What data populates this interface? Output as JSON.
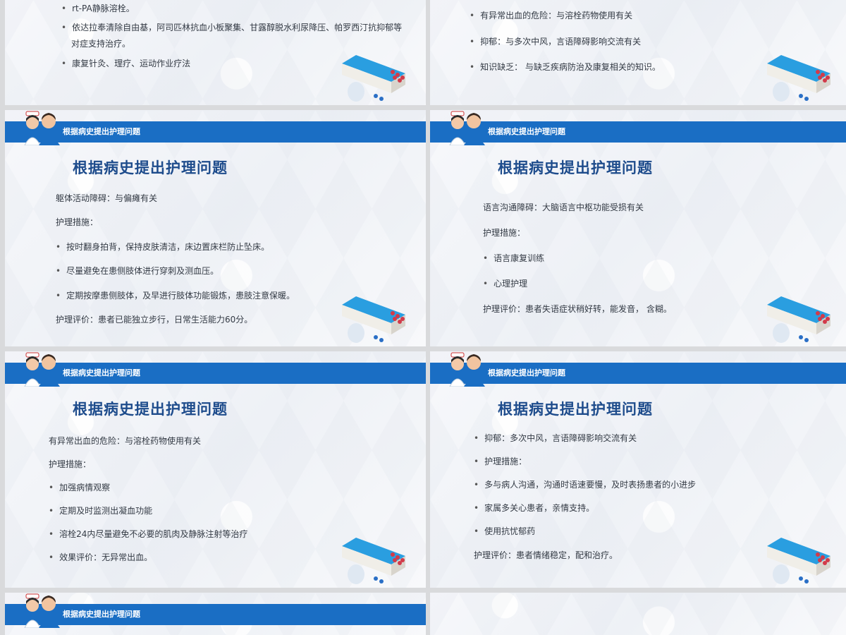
{
  "banner_title": "根据病史提出护理问题",
  "heading": "根据病史提出护理问题",
  "slides": {
    "s1": {
      "lines": [
        "rt-PA静脉溶栓。",
        "依达拉奉清除自由基，阿司匹林抗血小板聚集、甘露醇脱水利尿降压、帕罗西汀抗抑郁等",
        "对症支持治疗。",
        "康复针灸、理疗、运动作业疗法"
      ]
    },
    "s2": {
      "lines": [
        "有异常出血的危险：与溶栓药物使用有关",
        "抑郁：与多次中风，言语障碍影响交流有关",
        "知识缺乏： 与缺乏疾病防治及康复相关的知识。"
      ]
    },
    "s3": {
      "lines": [
        "躯体活动障碍：与偏瘫有关",
        "护理措施：",
        "按时翻身拍背，保持皮肤清洁，床边置床栏防止坠床。",
        "尽量避免在患侧肢体进行穿刺及测血压。",
        "定期按摩患侧肢体，及早进行肢体功能锻炼，患肢注意保暖。",
        "护理评价：患者已能独立步行，日常生活能力60分。"
      ]
    },
    "s4": {
      "lines": [
        "语言沟通障碍：大脑语言中枢功能受损有关",
        "护理措施：",
        "语言康复训练",
        "心理护理",
        "护理评价：患者失语症状稍好转，能发音， 含糊。"
      ]
    },
    "s5": {
      "lines": [
        "有异常出血的危险：与溶栓药物使用有关",
        "护理措施：",
        "加强病情观察",
        "定期及时监测出凝血功能",
        "溶栓24内尽量避免不必要的肌肉及静脉注射等治疗",
        "效果评价：无异常出血。"
      ]
    },
    "s6": {
      "lines": [
        "抑郁：多次中风，言语障碍影响交流有关",
        "护理措施：",
        "多与病人沟通，沟通时语速要慢，及时表扬患者的小进步",
        "家属多关心患者，亲情支持。",
        "使用抗忧郁药",
        "护理评价：患者情绪稳定，配和治疗。"
      ]
    }
  },
  "colors": {
    "banner": "#1a6ec4",
    "heading": "#1e4c8c"
  }
}
